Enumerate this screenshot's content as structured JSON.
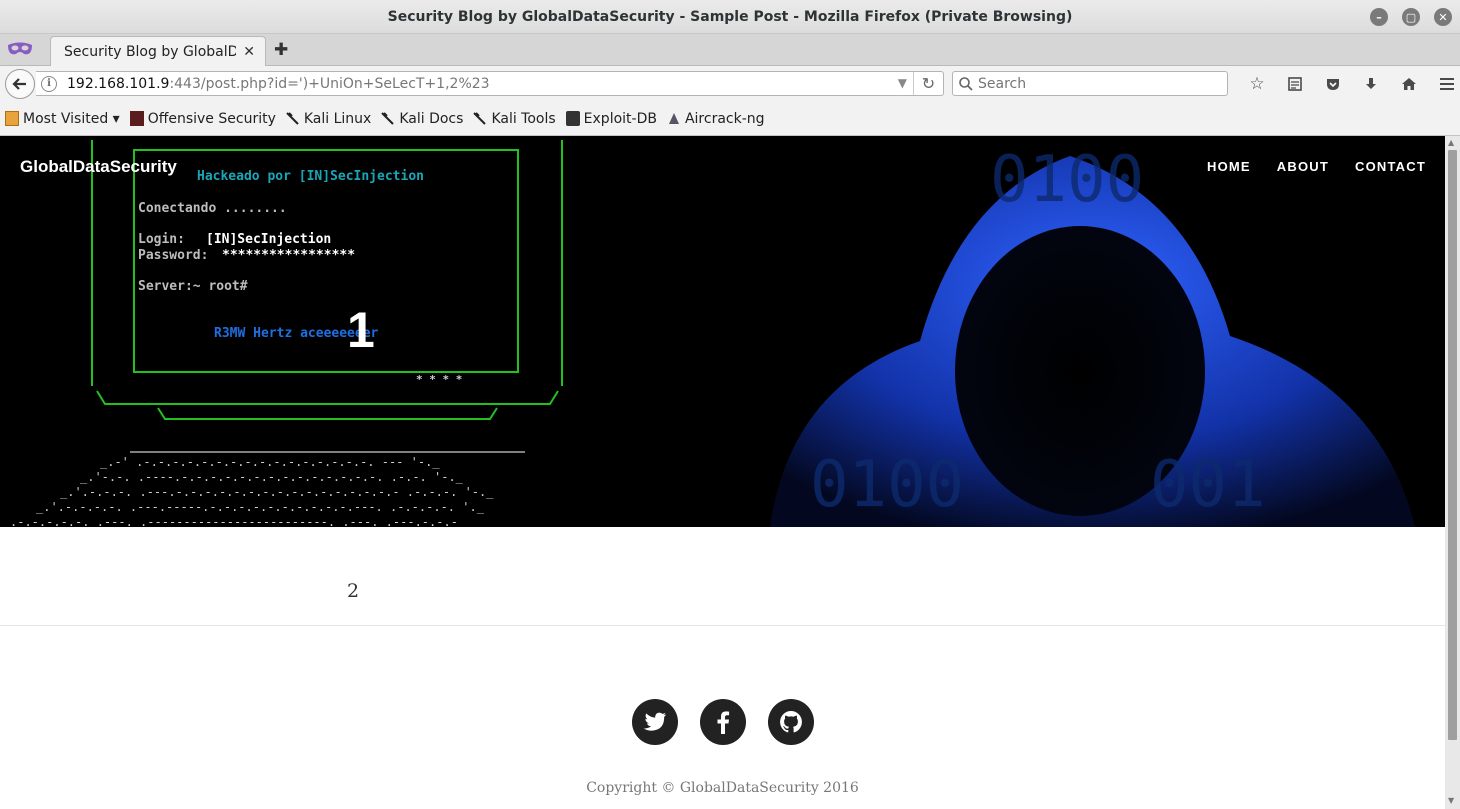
{
  "window": {
    "title": "Security Blog by GlobalDataSecurity - Sample Post - Mozilla Firefox (Private Browsing)"
  },
  "tabs": [
    {
      "label": "Security Blog by GlobalD…"
    }
  ],
  "navbar": {
    "url_host": "192.168.101.9",
    "url_rest": ":443/post.php?id=')+UniOn+SeLecT+1,2%23",
    "search_placeholder": "Search"
  },
  "bookmarks": [
    {
      "label": "Most Visited ▾",
      "icon": "most-visited-icon"
    },
    {
      "label": "Offensive Security",
      "icon": "offensive-security-icon"
    },
    {
      "label": "Kali Linux",
      "icon": "kali-dragon-icon"
    },
    {
      "label": "Kali Docs",
      "icon": "kali-dragon-icon"
    },
    {
      "label": "Kali Tools",
      "icon": "kali-dragon-icon"
    },
    {
      "label": "Exploit-DB",
      "icon": "exploit-db-icon"
    },
    {
      "label": "Aircrack-ng",
      "icon": "aircrack-icon"
    }
  ],
  "site": {
    "brand": "GlobalDataSecurity",
    "nav": [
      "HOME",
      "ABOUT",
      "CONTACT"
    ],
    "hero_heading": "1",
    "terminal": {
      "line1": "Hackeado por [IN]SecInjection",
      "line2": "Conectando ........",
      "line3_label": "Login:",
      "line3_value": "[IN]SecInjection",
      "line4_label": "Password:",
      "line4_value": "*****************",
      "line5": "Server:~ root#",
      "line6": "R3MW Hertz aceeeeeeer",
      "stars": "* * * *"
    },
    "post_body": "2",
    "copyright": "Copyright © GlobalDataSecurity 2016"
  },
  "colors": {
    "hero_bg": "#000000",
    "terminal_green": "#22c21e",
    "terminal_cyan": "#1aa6b7",
    "terminal_blue": "#1f6fe0",
    "hood_blue": "#1840c8"
  }
}
